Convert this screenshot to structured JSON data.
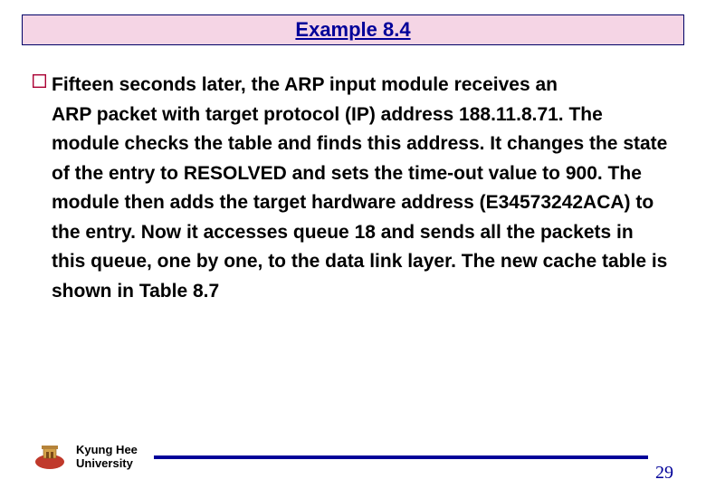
{
  "header": {
    "title": "Example 8.4"
  },
  "body": {
    "line1": "Fifteen seconds later, the ARP input module receives an",
    "rest": "ARP packet with target protocol (IP) address 188.11.8.71. The module checks the table and finds this address. It changes the state of the entry to RESOLVED and sets the time-out value to 900. The module then adds the target hardware address (E34573242ACA) to the entry. Now it accesses queue 18 and sends all the packets in this queue, one by one, to the data link layer. The new cache table is shown in Table 8.7"
  },
  "footer": {
    "university_line1": "Kyung Hee",
    "university_line2": "University",
    "page_number": "29"
  }
}
